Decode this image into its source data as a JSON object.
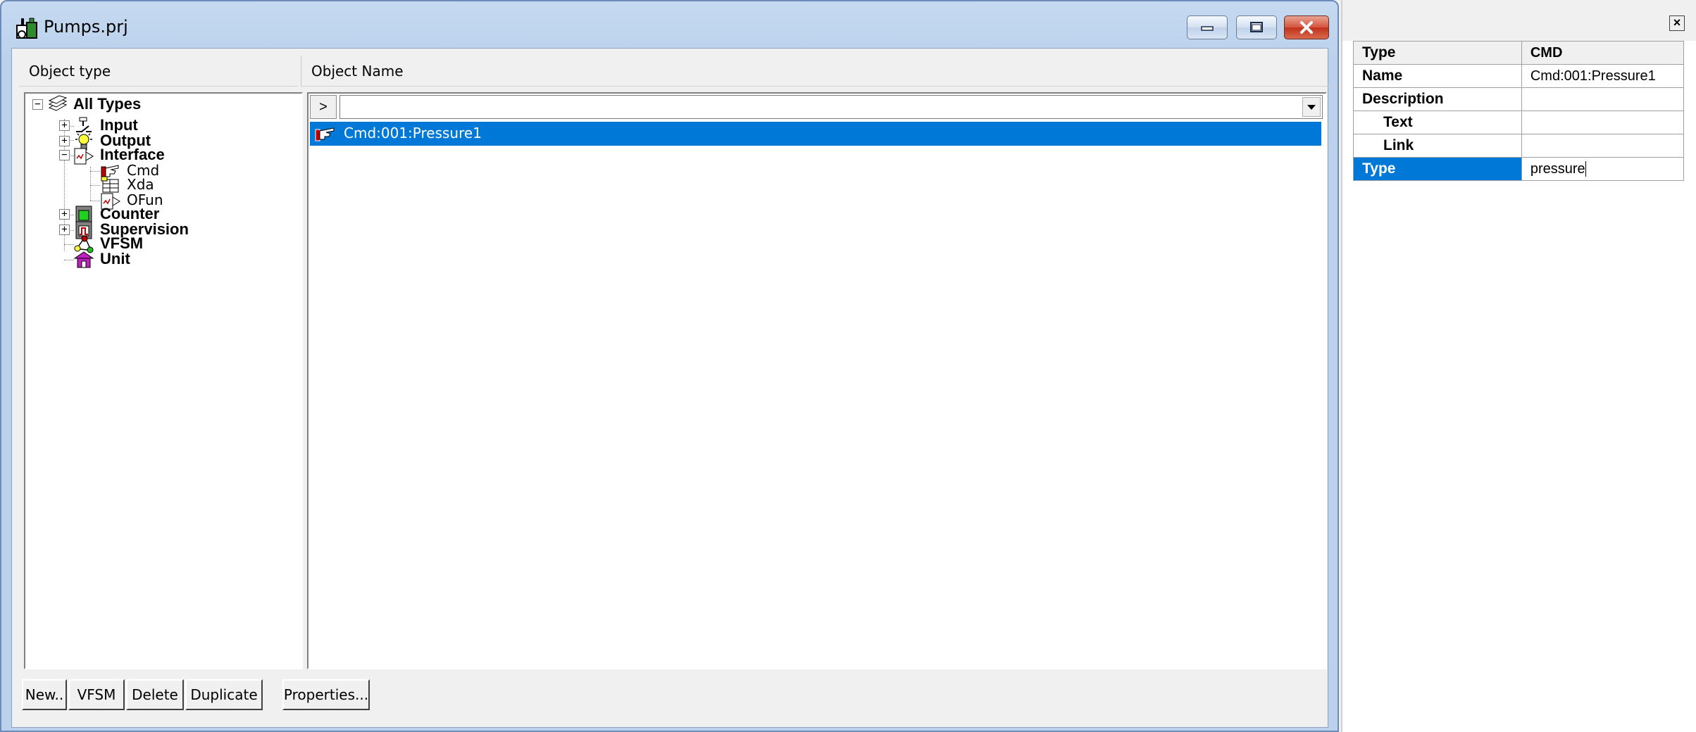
{
  "window": {
    "title": "Pumps.prj",
    "colors": {
      "title_bg": "#bcd2ec",
      "close": "#c0311a",
      "selection": "#0078d7"
    }
  },
  "headers": {
    "object_type": "Object type",
    "object_name": "Object Name"
  },
  "tree": {
    "root": "All Types",
    "input": "Input",
    "output": "Output",
    "interface": "Interface",
    "cmd": "Cmd",
    "xda": "Xda",
    "ofun": "OFun",
    "counter": "Counter",
    "supervision": "Supervision",
    "vfsm": "VFSM",
    "unit": "Unit"
  },
  "list": {
    "go_label": ">",
    "filter_value": "",
    "selected_item": "Cmd:001:Pressure1"
  },
  "buttons": {
    "new": "New..",
    "vfsm": "VFSM",
    "delete": "Delete",
    "duplicate": "Duplicate",
    "properties": "Properties..."
  },
  "props": {
    "header": {
      "key": "Type",
      "value": "CMD"
    },
    "name": {
      "key": "Name",
      "value": "Cmd:001:Pressure1"
    },
    "description": {
      "key": "Description",
      "value": ""
    },
    "text": {
      "key": "Text",
      "value": ""
    },
    "link": {
      "key": "Link",
      "value": ""
    },
    "type": {
      "key": "Type",
      "value": "pressure"
    }
  }
}
